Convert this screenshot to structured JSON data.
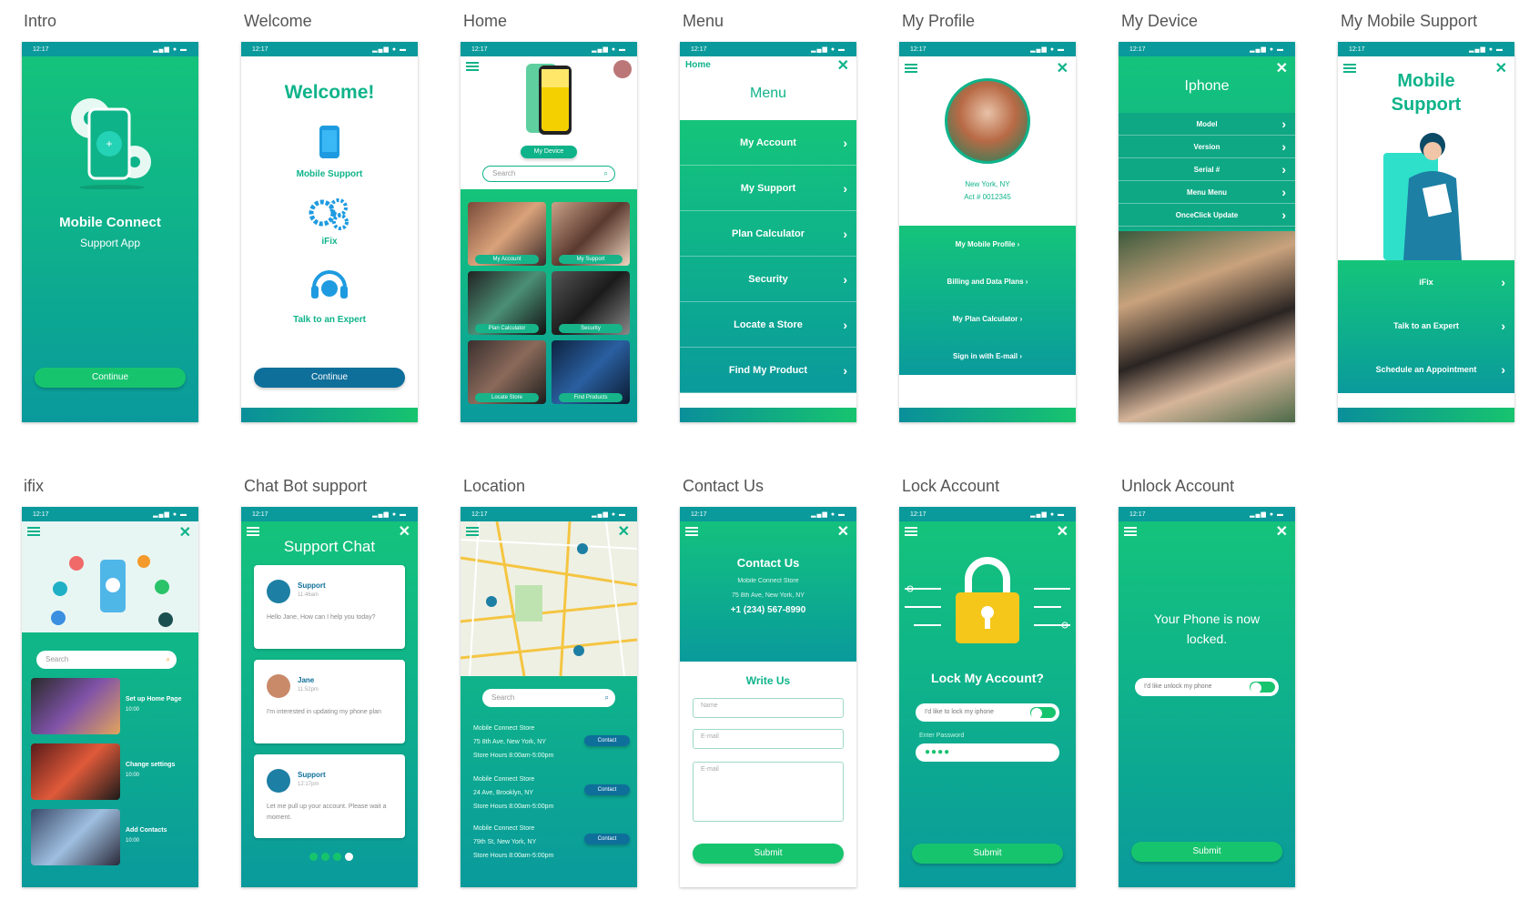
{
  "labels": [
    "Intro",
    "Welcome",
    "Home",
    "Menu",
    "My Profile",
    "My Device",
    "My Mobile Support",
    "ifix",
    "Chat Bot support",
    "Location",
    "Contact Us",
    "Lock Account",
    "Unlock Account"
  ],
  "status": {
    "time": "12:17"
  },
  "intro": {
    "title": "Mobile Connect",
    "subtitle": "Support App",
    "continue": "Continue"
  },
  "welcome": {
    "title": "Welcome!",
    "item1": "Mobile Support",
    "item2": "iFix",
    "item3": "Talk to an Expert",
    "continue": "Continue"
  },
  "home": {
    "device_btn": "My Device",
    "search": "Search",
    "tiles": [
      "My Account",
      "My Support",
      "Plan Calculator",
      "Security",
      "Locate Store",
      "Find Products"
    ]
  },
  "menu": {
    "top": "Home",
    "title": "Menu",
    "items": [
      "My Account",
      "My Support",
      "Plan Calculator",
      "Security",
      "Locate a Store",
      "Find My Product"
    ]
  },
  "profile": {
    "location": "New York, NY",
    "account": "Act # 0012345",
    "items": [
      "My Mobile Profile",
      "Billing and Data Plans",
      "My Plan Calculator",
      "Sign in with E-mail"
    ]
  },
  "device": {
    "title": "Iphone",
    "items": [
      "Model",
      "Version",
      "Serial #",
      "Menu Menu",
      "OnceClick Update"
    ]
  },
  "support": {
    "title_line1": "Mobile",
    "title_line2": "Support",
    "items": [
      "iFix",
      "Talk to an Expert",
      "Schedule an Appointment"
    ]
  },
  "ifix": {
    "search": "Search",
    "items": [
      {
        "title": "Set up Home Page",
        "time": "10:00"
      },
      {
        "title": "Change settings",
        "time": "10:00"
      },
      {
        "title": "Add Contacts",
        "time": "10:00"
      }
    ]
  },
  "chat": {
    "title": "Support Chat",
    "messages": [
      {
        "name": "Support",
        "time": "11:46am",
        "text": "Hello Jane, How can I help you today?"
      },
      {
        "name": "Jane",
        "time": "11:52pm",
        "text": "I'm interested in updating my phone plan"
      },
      {
        "name": "Support",
        "time": "12:17pm",
        "text": "Let me pull up your account. Please wait a moment."
      }
    ]
  },
  "location": {
    "search": "Search",
    "contact": "Contact",
    "stores": [
      [
        "Mobile Connect Store",
        "75 8th Ave, New York, NY",
        "Store Hours 8:00am-5:00pm"
      ],
      [
        "Mobile Connect Store",
        "24 Ave, Brooklyn, NY",
        "Store Hours 8:00am-5:00pm"
      ],
      [
        "Mobile Connect Store",
        "79th St, New York, NY",
        "Store Hours 8:00am-5:00pm"
      ]
    ]
  },
  "contact": {
    "title": "Contact Us",
    "store": "Mobile Connect Store",
    "address": "75 8th Ave, New York, NY",
    "phone": "+1 (234) 567-8990",
    "write": "Write Us",
    "name_ph": "Name",
    "email_ph": "E-mail",
    "msg_ph": "E-mail",
    "submit": "Submit"
  },
  "lock": {
    "title": "Lock My Account?",
    "toggle": "I'd like to lock my iphone",
    "pwd_label": "Enter Password",
    "pwd": "●●●●",
    "submit": "Submit"
  },
  "unlock": {
    "title": "Your Phone is now locked.",
    "toggle": "I'd like unlock my phone",
    "submit": "Submit"
  },
  "colors": {
    "green": "#17c46e",
    "teal": "#0fb38a",
    "blue": "#0f6f9b"
  }
}
